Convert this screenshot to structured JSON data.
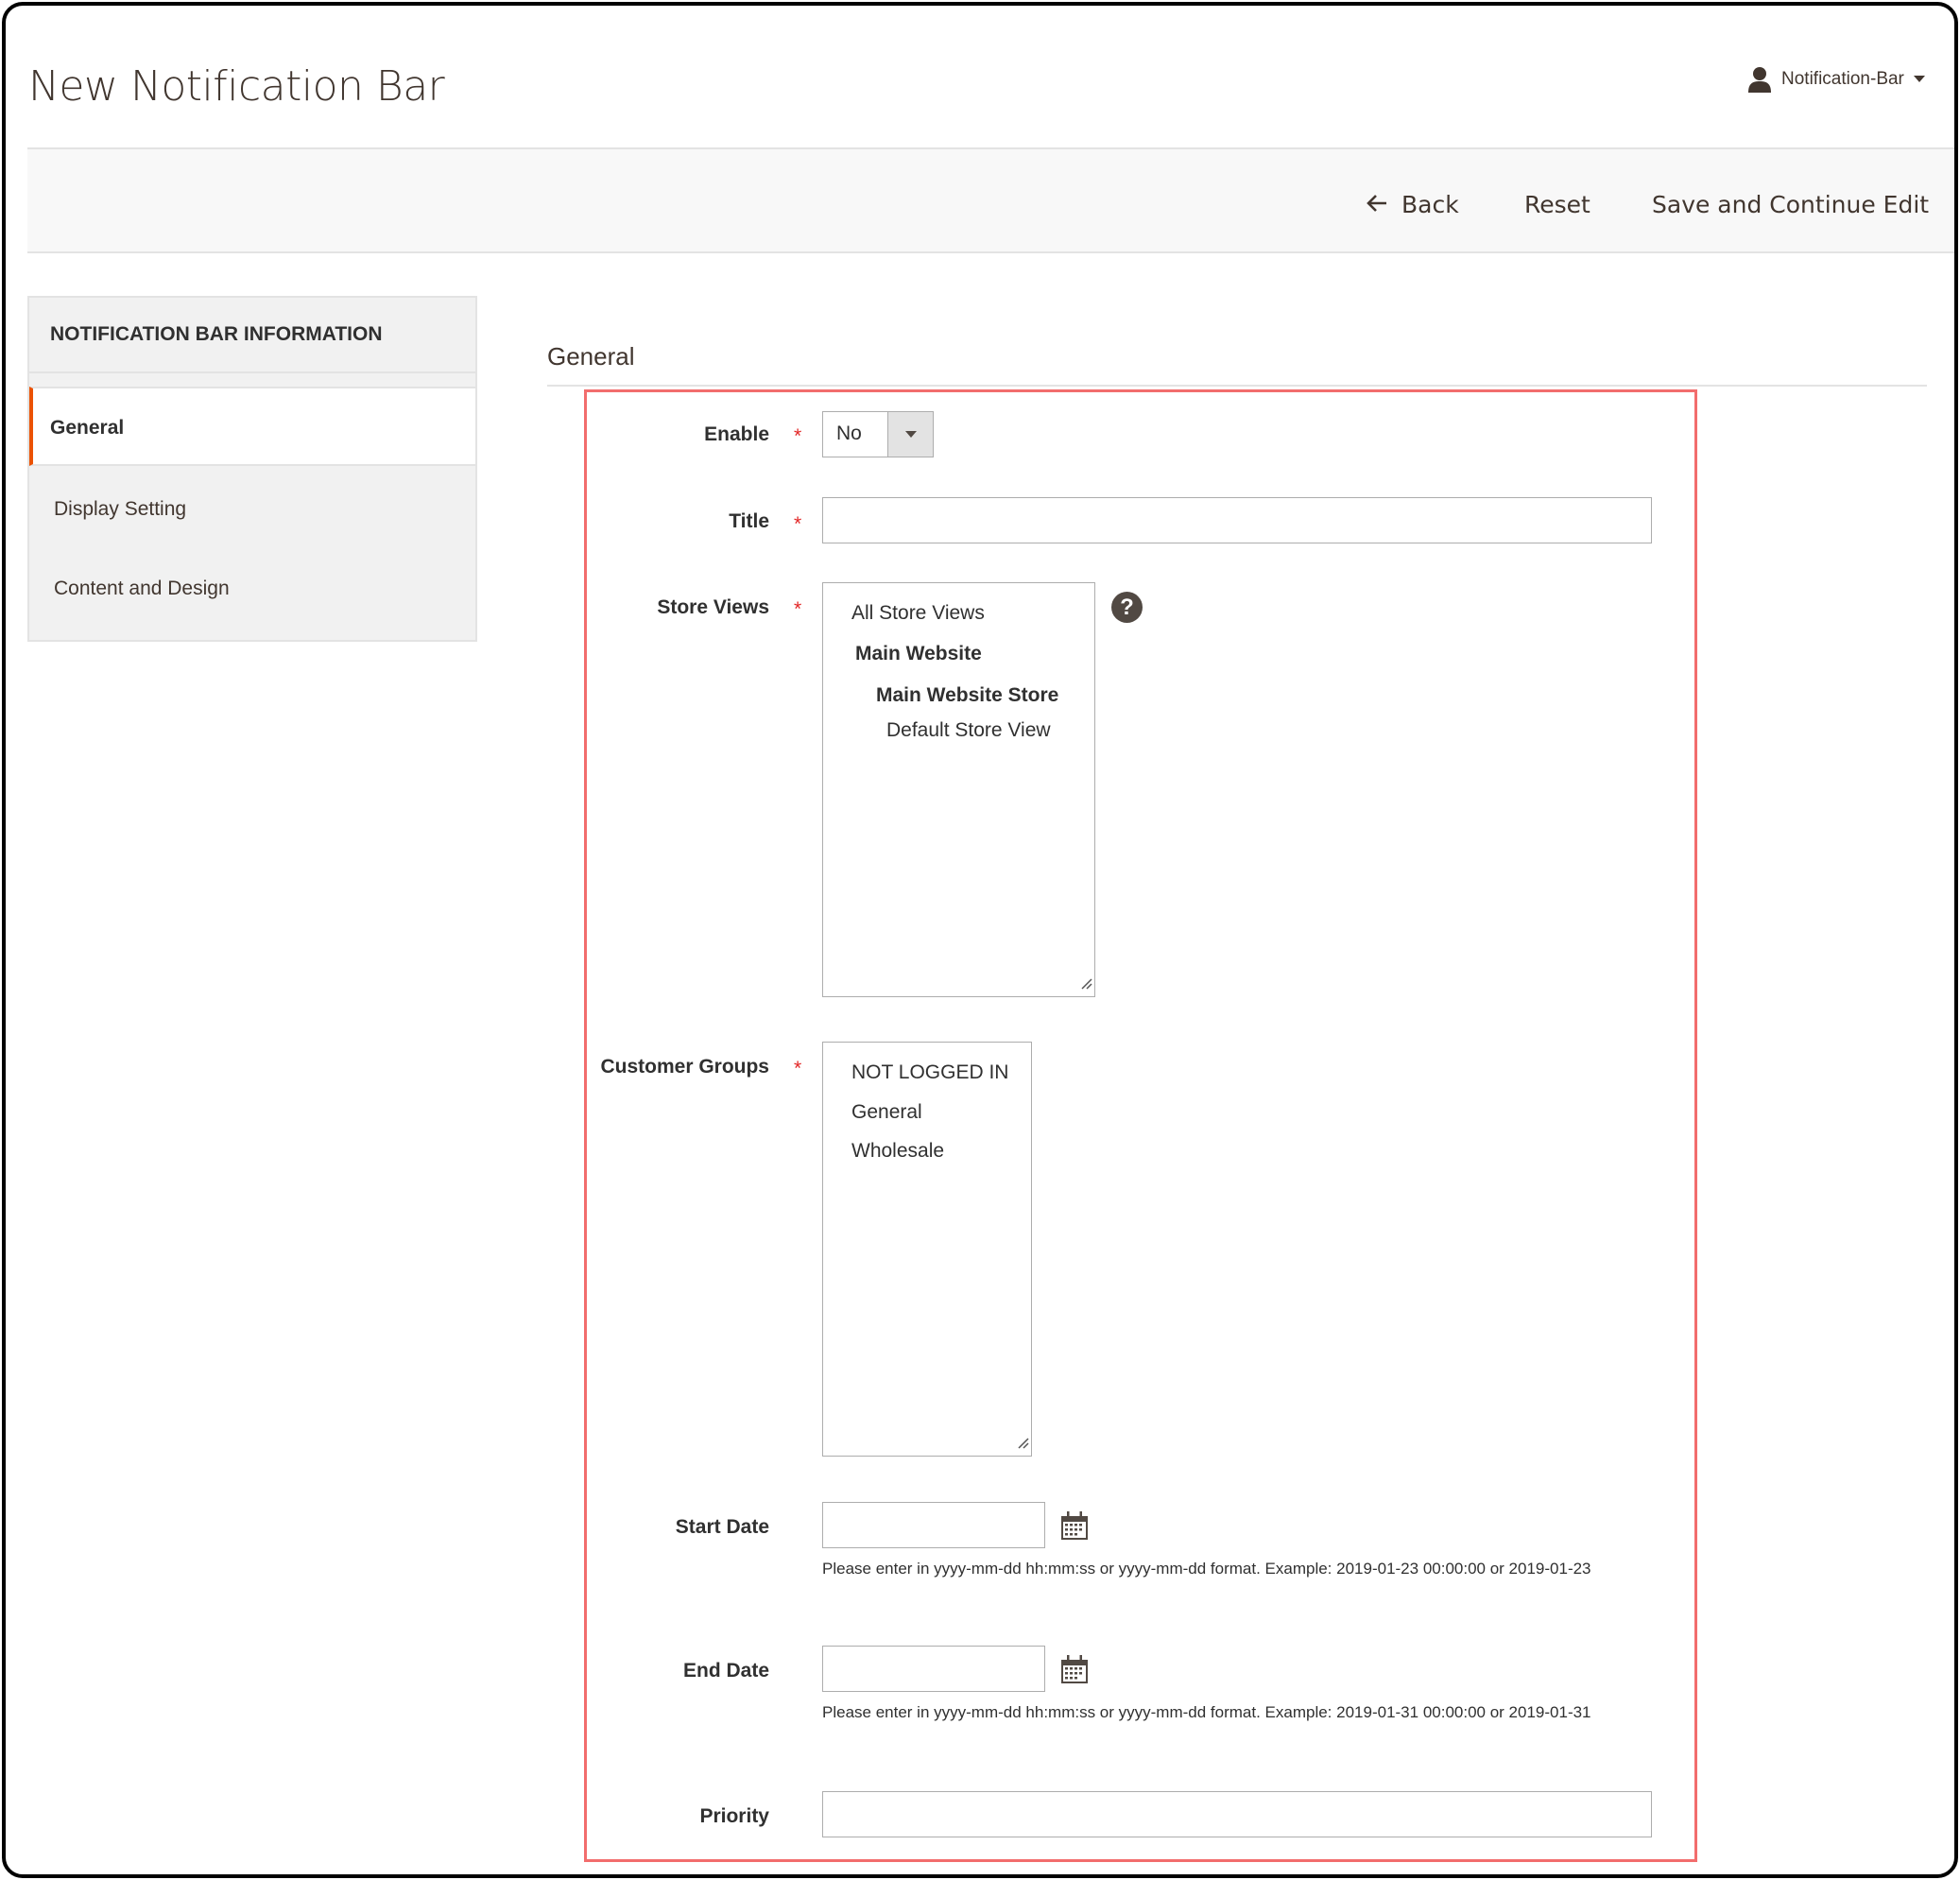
{
  "page": {
    "title": "New Notification Bar"
  },
  "user": {
    "name": "Notification-Bar",
    "icon": "user-icon",
    "dropdown_icon": "caret-down-icon"
  },
  "toolbar": {
    "back_label": "Back",
    "back_icon": "arrow-left-icon",
    "reset_label": "Reset",
    "save_continue_label": "Save and Continue Edit"
  },
  "sidebar": {
    "header": "NOTIFICATION BAR INFORMATION",
    "items": [
      {
        "label": "General",
        "active": true
      },
      {
        "label": "Display Setting",
        "active": false
      },
      {
        "label": "Content and Design",
        "active": false
      }
    ],
    "active_color": "#eb5202"
  },
  "section": {
    "title": "General"
  },
  "form": {
    "enable": {
      "label": "Enable",
      "required": true,
      "value": "No"
    },
    "title": {
      "label": "Title",
      "required": true,
      "value": ""
    },
    "store_views": {
      "label": "Store Views",
      "required": true,
      "help_icon": "question-circle-icon",
      "options": [
        {
          "label": "All Store Views",
          "bold": false
        },
        {
          "label": "Main Website",
          "bold": true
        },
        {
          "label": "Main Website Store",
          "bold": true
        },
        {
          "label": "Default Store View",
          "bold": false
        }
      ]
    },
    "customer_groups": {
      "label": "Customer Groups",
      "required": true,
      "options": [
        "NOT LOGGED IN",
        "General",
        "Wholesale"
      ]
    },
    "start_date": {
      "label": "Start Date",
      "value": "",
      "icon": "calendar-icon",
      "note": "Please enter in yyyy-mm-dd hh:mm:ss or yyyy-mm-dd format. Example: 2019-01-23 00:00:00 or 2019-01-23"
    },
    "end_date": {
      "label": "End Date",
      "value": "",
      "icon": "calendar-icon",
      "note": "Please enter in yyyy-mm-dd hh:mm:ss or yyyy-mm-dd format. Example: 2019-01-31 00:00:00 or 2019-01-31"
    },
    "priority": {
      "label": "Priority",
      "value": ""
    },
    "required_marker": "*",
    "highlight_color": "#f26d6d"
  }
}
